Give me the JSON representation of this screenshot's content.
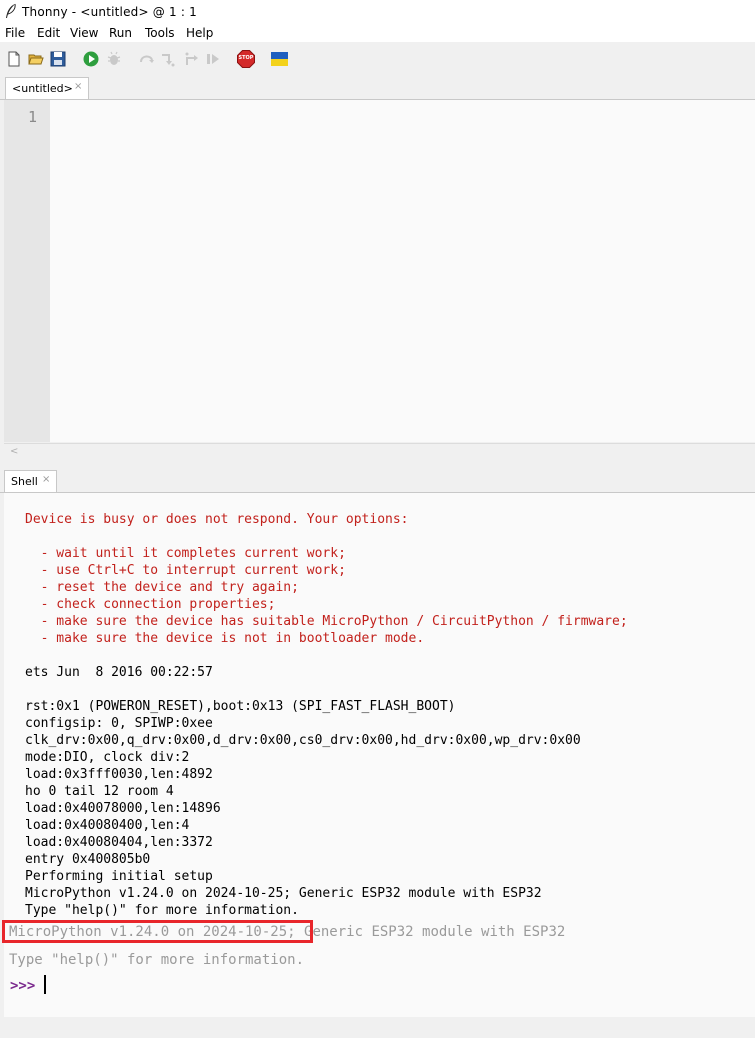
{
  "window": {
    "title": "Thonny  -  <untitled>  @  1 : 1"
  },
  "menu": [
    "File",
    "Edit",
    "View",
    "Run",
    "Tools",
    "Help"
  ],
  "toolbar": {
    "icons": [
      "new-file-icon",
      "open-file-icon",
      "save-icon",
      "run-icon",
      "debug-icon",
      "step-over-icon",
      "step-into-icon",
      "step-out-icon",
      "resume-icon",
      "stop-icon",
      "ukraine-flag-icon"
    ],
    "stop_label": "STOP",
    "colors": {
      "run": "#2e9e3e",
      "stop": "#d42a2a",
      "flag_blue": "#1f5fbf",
      "flag_yellow": "#f3d21b"
    }
  },
  "editor": {
    "tab_label": "<untitled>",
    "tab_close": "×",
    "line_numbers": [
      "1"
    ]
  },
  "shell": {
    "tab_label": "Shell",
    "tab_close": "×",
    "error_lines": [
      "Device is busy or does not respond. Your options:",
      "",
      "  - wait until it completes current work;",
      "  - use Ctrl+C to interrupt current work;",
      "  - reset the device and try again;",
      "  - check connection properties;",
      "  - make sure the device has suitable MicroPython / CircuitPython / firmware;",
      "  - make sure the device is not in bootloader mode."
    ],
    "output_lines": [
      "ets Jun  8 2016 00:22:57",
      "",
      "rst:0x1 (POWERON_RESET),boot:0x13 (SPI_FAST_FLASH_BOOT)",
      "configsip: 0, SPIWP:0xee",
      "clk_drv:0x00,q_drv:0x00,d_drv:0x00,cs0_drv:0x00,hd_drv:0x00,wp_drv:0x00",
      "mode:DIO, clock div:2",
      "load:0x3fff0030,len:4892",
      "ho 0 tail 12 room 4",
      "load:0x40078000,len:14896",
      "load:0x40080400,len:4",
      "load:0x40080404,len:3372",
      "entry 0x400805b0",
      "Performing initial setup",
      "MicroPython v1.24.0 on 2024-10-25; Generic ESP32 module with ESP32",
      "Type \"help()\" for more information."
    ],
    "banner_highlighted": "MicroPython v1.24.0 on 2024-10-25",
    "banner_rest": "; Generic ESP32 module with ESP32",
    "banner_help": "Type \"help()\" for more information.",
    "prompt": ">>>"
  }
}
